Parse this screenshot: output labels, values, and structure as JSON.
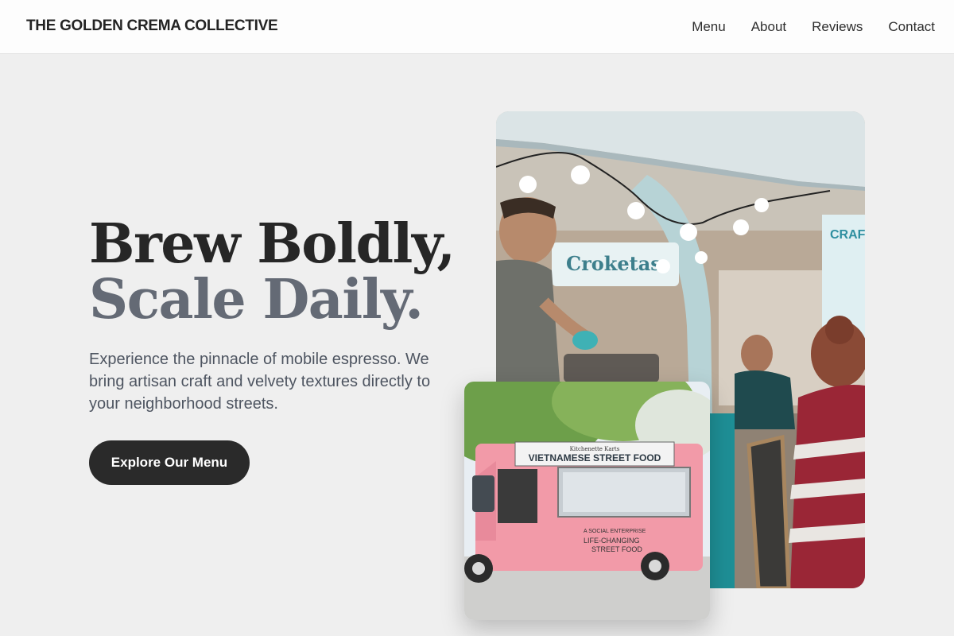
{
  "brand": {
    "name": "THE GOLDEN CREMA COLLECTIVE"
  },
  "nav": {
    "items": [
      "Menu",
      "About",
      "Reviews",
      "Contact"
    ]
  },
  "hero": {
    "headline_line1": "Brew Boldly,",
    "headline_line2": "Scale Daily.",
    "lead": "Experience the pinnacle of mobile espresso. We bring artisan craft and velvety textures directly to your neighborhood streets.",
    "cta_label": "Explore Our Menu"
  },
  "images": {
    "main": {
      "sign_text": "Croketas",
      "side_sign": "CRAFT BEER & FOOD"
    },
    "secondary": {
      "sign_small": "Kitchenette Karts",
      "sign_main": "VIETNAMESE STREET FOOD",
      "side_text_1": "A SOCIAL ENTERPRISE",
      "side_text_2": "LIFE-CHANGING",
      "side_text_3": "STREET FOOD"
    }
  },
  "colors": {
    "background": "#efefef",
    "headline_dark": "#262626",
    "headline_muted": "#646a75",
    "button": "#2a2a2a",
    "truck_pink": "#f29aa8"
  }
}
